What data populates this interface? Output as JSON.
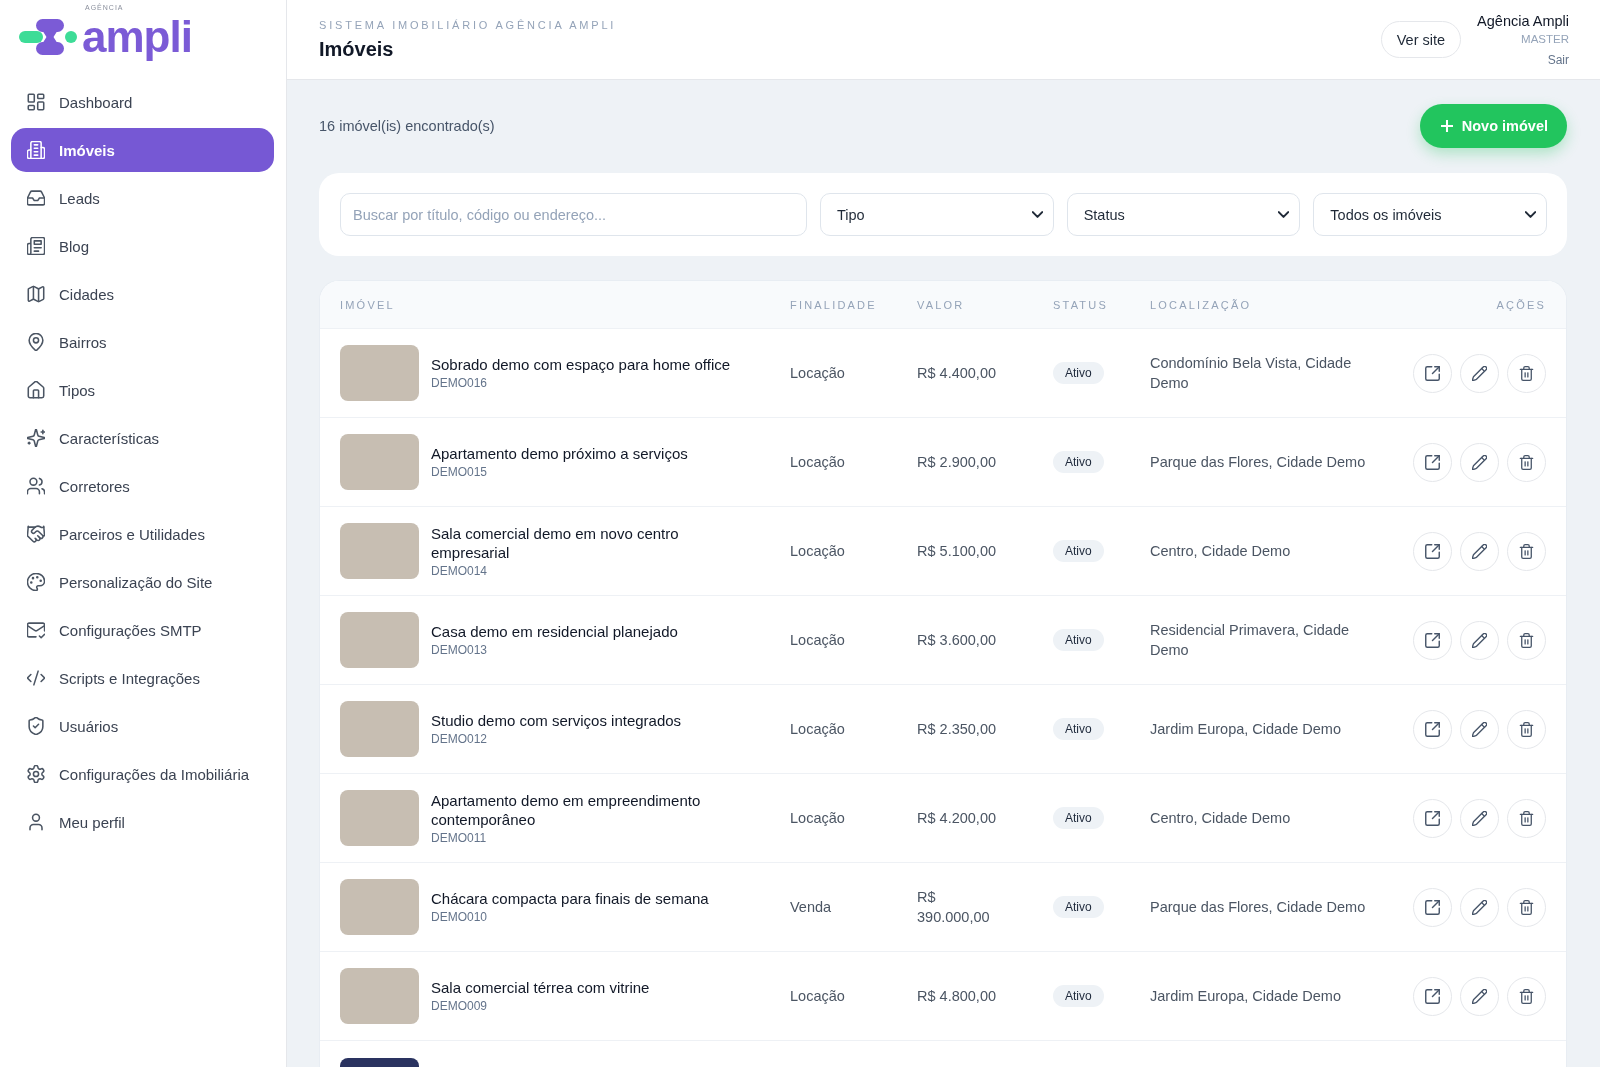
{
  "sidebar": {
    "logo": {
      "tagline": "AGÊNCIA",
      "wordmark": "ampli"
    },
    "items": [
      {
        "label": "Dashboard",
        "selected": false
      },
      {
        "label": "Imóveis",
        "selected": true
      },
      {
        "label": "Leads",
        "selected": false
      },
      {
        "label": "Blog",
        "selected": false
      },
      {
        "label": "Cidades",
        "selected": false
      },
      {
        "label": "Bairros",
        "selected": false
      },
      {
        "label": "Tipos",
        "selected": false
      },
      {
        "label": "Características",
        "selected": false
      },
      {
        "label": "Corretores",
        "selected": false
      },
      {
        "label": "Parceiros e Utilidades",
        "selected": false
      },
      {
        "label": "Personalização do Site",
        "selected": false
      },
      {
        "label": "Configurações SMTP",
        "selected": false
      },
      {
        "label": "Scripts e Integrações",
        "selected": false
      },
      {
        "label": "Usuários",
        "selected": false
      },
      {
        "label": "Configurações da Imobiliária",
        "selected": false
      },
      {
        "label": "Meu perfil",
        "selected": false
      }
    ]
  },
  "header": {
    "eyebrow": "SISTEMA IMOBILIÁRIO AGÊNCIA AMPLI",
    "title": "Imóveis",
    "view_site": "Ver site",
    "user": {
      "name": "Agência Ampli",
      "role": "MASTER",
      "logout": "Sair"
    }
  },
  "toolbar": {
    "count": "16 imóvel(is) encontrado(s)",
    "new_button": "Novo imóvel"
  },
  "filters": {
    "search": {
      "placeholder": "Buscar por título, código ou endereço..."
    },
    "selects": [
      {
        "value": "Tipo"
      },
      {
        "value": "Status"
      },
      {
        "value": "Todos os imóveis"
      }
    ]
  },
  "table": {
    "columns": [
      "IMÓVEL",
      "FINALIDADE",
      "VALOR",
      "STATUS",
      "LOCALIZAÇÃO",
      "AÇÕES"
    ],
    "rows": [
      {
        "title": "Sobrado demo com espaço para home office",
        "code": "DEMO016",
        "purpose": "Locação",
        "price": "R$ 4.400,00",
        "status": "Ativo",
        "location": "Condomínio Bela Vista, Cidade Demo"
      },
      {
        "title": "Apartamento demo próximo a serviços",
        "code": "DEMO015",
        "purpose": "Locação",
        "price": "R$ 2.900,00",
        "status": "Ativo",
        "location": "Parque das Flores, Cidade Demo"
      },
      {
        "title": "Sala comercial demo em novo centro empresarial",
        "code": "DEMO014",
        "purpose": "Locação",
        "price": "R$ 5.100,00",
        "status": "Ativo",
        "location": "Centro, Cidade Demo"
      },
      {
        "title": "Casa demo em residencial planejado",
        "code": "DEMO013",
        "purpose": "Locação",
        "price": "R$ 3.600,00",
        "status": "Ativo",
        "location": "Residencial Primavera, Cidade Demo"
      },
      {
        "title": "Studio demo com serviços integrados",
        "code": "DEMO012",
        "purpose": "Locação",
        "price": "R$ 2.350,00",
        "status": "Ativo",
        "location": "Jardim Europa, Cidade Demo"
      },
      {
        "title": "Apartamento demo em empreendimento contemporâneo",
        "code": "DEMO011",
        "purpose": "Locação",
        "price": "R$ 4.200,00",
        "status": "Ativo",
        "location": "Centro, Cidade Demo"
      },
      {
        "title": "Chácara compacta para finais de semana",
        "code": "DEMO010",
        "purpose": "Venda",
        "price": "R$ 390.000,00",
        "status": "Ativo",
        "location": "Parque das Flores, Cidade Demo"
      },
      {
        "title": "Sala comercial térrea com vitrine",
        "code": "DEMO009",
        "purpose": "Locação",
        "price": "R$ 4.800,00",
        "status": "Ativo",
        "location": "Jardim Europa, Cidade Demo"
      }
    ],
    "more_rows_below": true
  }
}
